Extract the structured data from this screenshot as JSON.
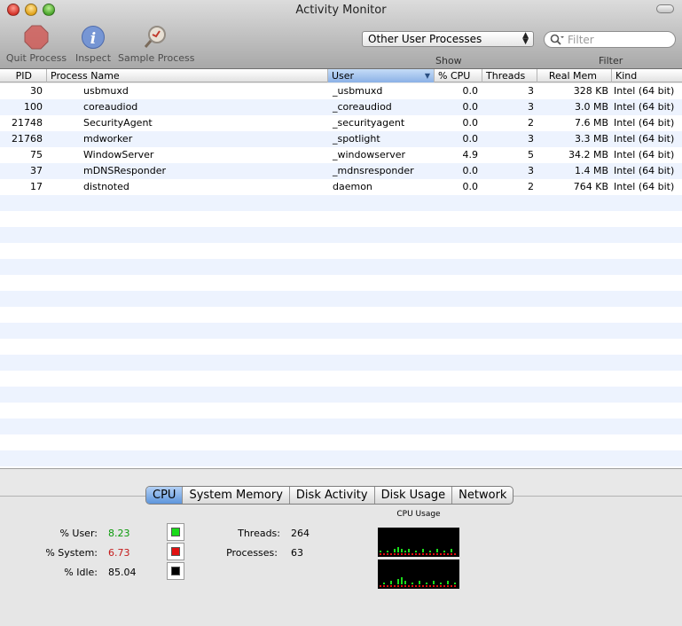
{
  "window": {
    "title": "Activity Monitor"
  },
  "toolbar": {
    "quit_label": "Quit Process",
    "inspect_label": "Inspect",
    "sample_label": "Sample Process",
    "show_value": "Other User Processes",
    "show_label": "Show",
    "filter_placeholder": "Filter",
    "filter_label": "Filter"
  },
  "table": {
    "columns": [
      "PID",
      "Process Name",
      "User",
      "% CPU",
      "Threads",
      "Real Mem",
      "Kind"
    ],
    "sorted_column": "User",
    "rows": [
      {
        "pid": "30",
        "name": "usbmuxd",
        "user": "_usbmuxd",
        "cpu": "0.0",
        "threads": "3",
        "mem": "328 KB",
        "kind": "Intel (64 bit)"
      },
      {
        "pid": "100",
        "name": "coreaudiod",
        "user": "_coreaudiod",
        "cpu": "0.0",
        "threads": "3",
        "mem": "3.0 MB",
        "kind": "Intel (64 bit)"
      },
      {
        "pid": "21748",
        "name": "SecurityAgent",
        "user": "_securityagent",
        "cpu": "0.0",
        "threads": "2",
        "mem": "7.6 MB",
        "kind": "Intel (64 bit)"
      },
      {
        "pid": "21768",
        "name": "mdworker",
        "user": "_spotlight",
        "cpu": "0.0",
        "threads": "3",
        "mem": "3.3 MB",
        "kind": "Intel (64 bit)"
      },
      {
        "pid": "75",
        "name": "WindowServer",
        "user": "_windowserver",
        "cpu": "4.9",
        "threads": "5",
        "mem": "34.2 MB",
        "kind": "Intel (64 bit)"
      },
      {
        "pid": "37",
        "name": "mDNSResponder",
        "user": "_mdnsresponder",
        "cpu": "0.0",
        "threads": "3",
        "mem": "1.4 MB",
        "kind": "Intel (64 bit)"
      },
      {
        "pid": "17",
        "name": "distnoted",
        "user": "daemon",
        "cpu": "0.0",
        "threads": "2",
        "mem": "764 KB",
        "kind": "Intel (64 bit)"
      }
    ]
  },
  "tabs": [
    "CPU",
    "System Memory",
    "Disk Activity",
    "Disk Usage",
    "Network"
  ],
  "active_tab": "CPU",
  "cpu": {
    "user_label": "% User:",
    "user_value": "8.23",
    "user_color": "#0a9a0a",
    "system_label": "% System:",
    "system_value": "6.73",
    "system_color": "#c41a1a",
    "idle_label": "% Idle:",
    "idle_value": "85.04",
    "threads_label": "Threads:",
    "threads_value": "264",
    "processes_label": "Processes:",
    "processes_value": "63",
    "graph_title": "CPU Usage"
  },
  "colors": {
    "user_swatch": "#1adb1a",
    "system_swatch": "#e01010",
    "idle_swatch": "#000000",
    "sort_highlight": "#8bb1e6"
  },
  "icons": {
    "quit": "stop-octagon-icon",
    "inspect": "info-icon",
    "sample": "magnifier-sample-icon",
    "search": "search-icon"
  }
}
